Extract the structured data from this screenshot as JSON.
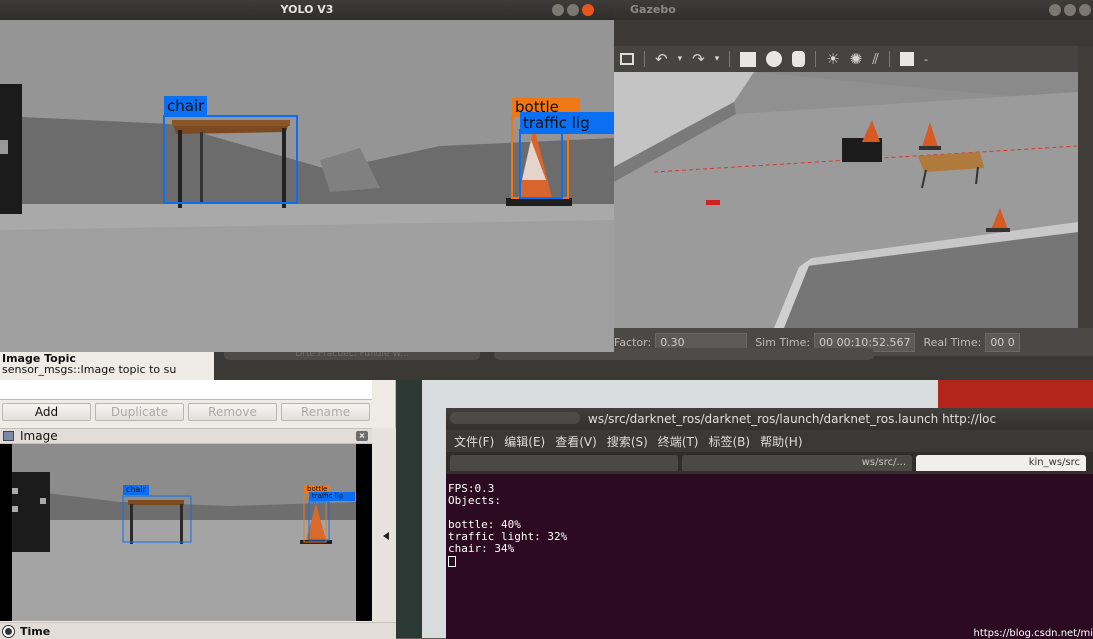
{
  "yolo_window": {
    "title": "YOLO V3",
    "detections": [
      {
        "label": "chair",
        "color": "#0a6ff2"
      },
      {
        "label": "bottle",
        "color": "#f07814"
      },
      {
        "label": "traffic lig",
        "color": "#0a6ff2"
      }
    ]
  },
  "gazebo_window": {
    "title": "Gazebo",
    "status": {
      "factor_label": "Factor:",
      "factor_value": "0.30",
      "sim_time_label": "Sim Time:",
      "sim_time_value": "00 00:10:52.567",
      "real_time_label": "Real Time:",
      "real_time_value": "00 0"
    },
    "bottom_tab": "Drte Practiec: Fundle W..."
  },
  "rviz_panel": {
    "topic_title": "Image Topic",
    "topic_desc": "sensor_msgs::Image topic to su",
    "buttons": {
      "add": "Add",
      "duplicate": "Duplicate",
      "remove": "Remove",
      "rename": "Rename"
    },
    "image_panel_title": "Image",
    "close_glyph": "×",
    "thumb_labels": {
      "chair": "chair",
      "bottle": "bottle",
      "traffic": "traffic lig"
    },
    "time_title": "Time"
  },
  "terminal": {
    "title": "ws/src/darknet_ros/darknet_ros/launch/darknet_ros.launch http://loc",
    "menu": [
      "文件(F)",
      "编辑(E)",
      "查看(V)",
      "搜索(S)",
      "终端(T)",
      "标签(B)",
      "帮助(H)"
    ],
    "tabs": [
      "",
      "ws/src/...",
      "kin_ws/src"
    ],
    "lines": {
      "fps": "FPS:0.3",
      "objects": "Objects:",
      "bottle": "bottle: 40%",
      "traffic": "traffic light: 32%",
      "chair": "chair: 34%"
    },
    "watermark": "https://blog.csdn.net/mi"
  },
  "colors": {
    "orange_accent": "#e9541f",
    "terminal_bg": "#2c0a22",
    "blue_box": "#0a6ff2",
    "orange_box": "#f07814"
  }
}
